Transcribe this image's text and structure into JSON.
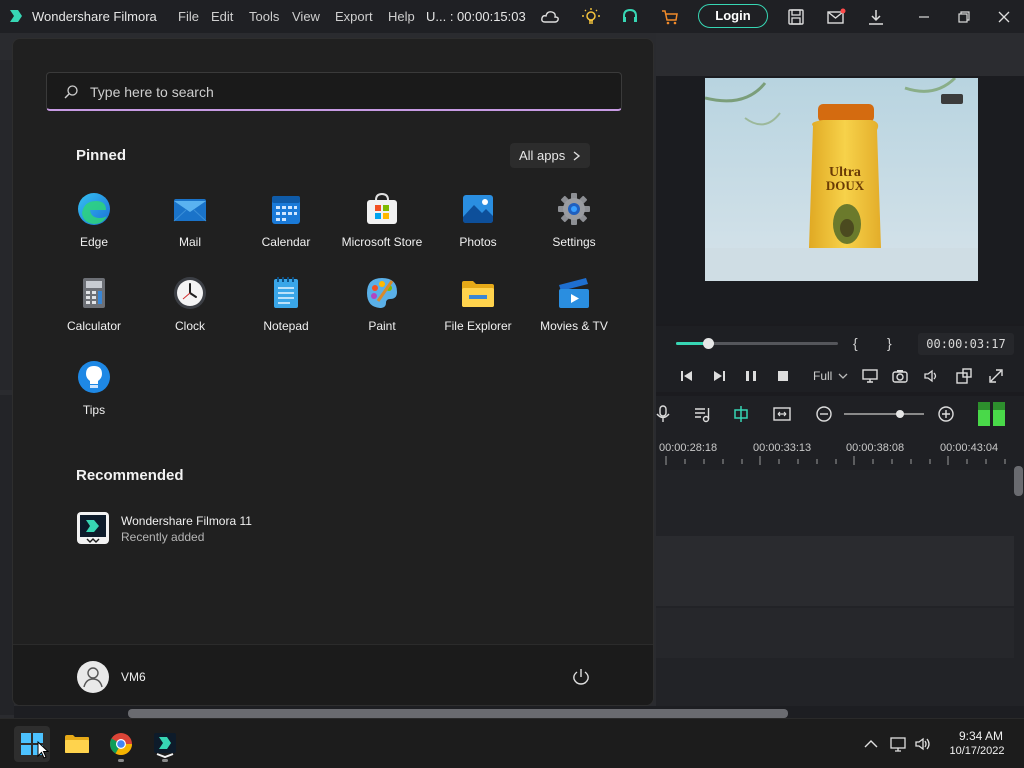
{
  "titlebar": {
    "app_title": "Wondershare Filmora",
    "menu": [
      "File",
      "Edit",
      "Tools",
      "View",
      "Export",
      "Help"
    ],
    "project_status": "U... : 00:00:15:03",
    "login_label": "Login"
  },
  "player": {
    "current_time": "00:00:03:17",
    "quality": "Full",
    "mark_in": "{",
    "mark_out": "}",
    "progress_fraction": 0.2
  },
  "timeline": {
    "ruler_labels": [
      "00:00:28:18",
      "00:00:33:13",
      "00:00:38:08",
      "00:00:43:04"
    ],
    "zoom_fraction": 0.7
  },
  "start_menu": {
    "search_placeholder": "Type here to search",
    "pinned_title": "Pinned",
    "all_apps_label": "All apps",
    "pinned": [
      {
        "label": "Edge",
        "icon": "edge-icon"
      },
      {
        "label": "Mail",
        "icon": "mail-icon"
      },
      {
        "label": "Calendar",
        "icon": "calendar-icon"
      },
      {
        "label": "Microsoft Store",
        "icon": "store-icon"
      },
      {
        "label": "Photos",
        "icon": "photos-icon"
      },
      {
        "label": "Settings",
        "icon": "gear-icon"
      },
      {
        "label": "Calculator",
        "icon": "calculator-icon"
      },
      {
        "label": "Clock",
        "icon": "clock-icon"
      },
      {
        "label": "Notepad",
        "icon": "notepad-icon"
      },
      {
        "label": "Paint",
        "icon": "paint-icon"
      },
      {
        "label": "File Explorer",
        "icon": "folder-icon"
      },
      {
        "label": "Movies & TV",
        "icon": "movies-icon"
      },
      {
        "label": "Tips",
        "icon": "lightbulb-icon"
      }
    ],
    "recommended_title": "Recommended",
    "recommended": [
      {
        "name": "Wondershare Filmora 11",
        "subtitle": "Recently added"
      }
    ],
    "user_name": "VM6"
  },
  "taskbar": {
    "time": "9:34 AM",
    "date": "10/17/2022"
  },
  "colors": {
    "accent_teal": "#37d6b4",
    "search_underline": "#c79be3",
    "start_bg": "#202020"
  }
}
